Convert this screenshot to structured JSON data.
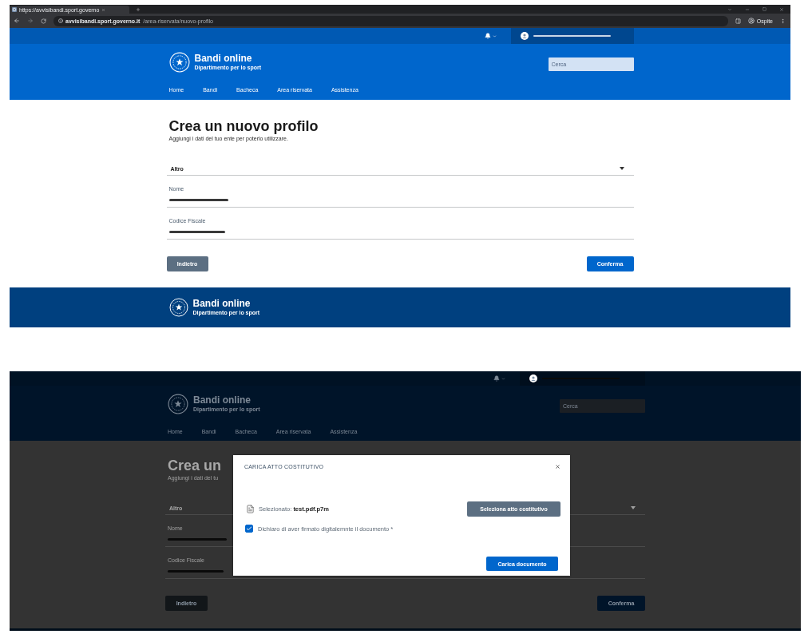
{
  "top_screenshot": {
    "backdrop": false,
    "browser": {
      "tabs": [
        {
          "title": "https://avvisibandi.sport.governo",
          "selected": true
        }
      ],
      "address": {
        "host": "avvisibandi.sport.governo.it",
        "path": "/area-riservata/nuovo-profilo"
      },
      "profile": "Ospite"
    },
    "site": {
      "brand": {
        "title": "Bandi online",
        "subtitle": "Dipartimento per lo sport"
      },
      "search": {
        "placeholder": "Cerca"
      },
      "nav": [
        {
          "label": "Home"
        },
        {
          "label": "Bandi"
        },
        {
          "label": "Bacheca"
        },
        {
          "label": "Area riservata"
        },
        {
          "label": "Assistenza"
        }
      ],
      "page": {
        "title": "Crea un nuovo profilo",
        "subtitle": "Aggiungi i dati del tuo ente per poterlo utilizzare.",
        "select": {
          "value": "Altro"
        },
        "fields": [
          {
            "label": "Nome",
            "redacted": true
          },
          {
            "label": "Codice Fiscale",
            "redacted": true
          }
        ],
        "buttons": [
          {
            "label": "Indietro",
            "kind": "secondary"
          },
          {
            "label": "Conferma",
            "kind": "primary"
          }
        ]
      },
      "footer": {
        "title": "Bandi online",
        "subtitle": "Dipartimento per lo sport"
      }
    }
  },
  "bottom_screenshot": {
    "backdrop": true,
    "site": {
      "brand": {
        "title": "Bandi online",
        "subtitle": "Dipartimento per lo sport"
      },
      "search": {
        "placeholder": "Cerca"
      },
      "nav": [
        {
          "label": "Home"
        },
        {
          "label": "Bandi"
        },
        {
          "label": "Bacheca"
        },
        {
          "label": "Area riservata"
        },
        {
          "label": "Assistenza"
        }
      ],
      "page": {
        "title": "Crea un",
        "subtitle": "Aggiungi i dati del tu",
        "select": {
          "value": "Altro"
        },
        "fields": [
          {
            "label": "Nome",
            "redacted": true
          },
          {
            "label": "Codice Fiscale",
            "redacted": true
          }
        ],
        "buttons": [
          {
            "label": "Indietro",
            "kind": "secondary"
          },
          {
            "label": "Conferma",
            "kind": "primary"
          }
        ]
      }
    },
    "modal": {
      "title": "CARICA ATTO COSTITUTIVO",
      "file": "Selezionato: **test.pdf.p7m**",
      "select_button": "Seleziona atto costitutivo",
      "checkbox": {
        "label": "Dichiaro di aver firmato digitalemnte il documento *",
        "checked": true
      },
      "submit_button": "Carica documento"
    }
  }
}
